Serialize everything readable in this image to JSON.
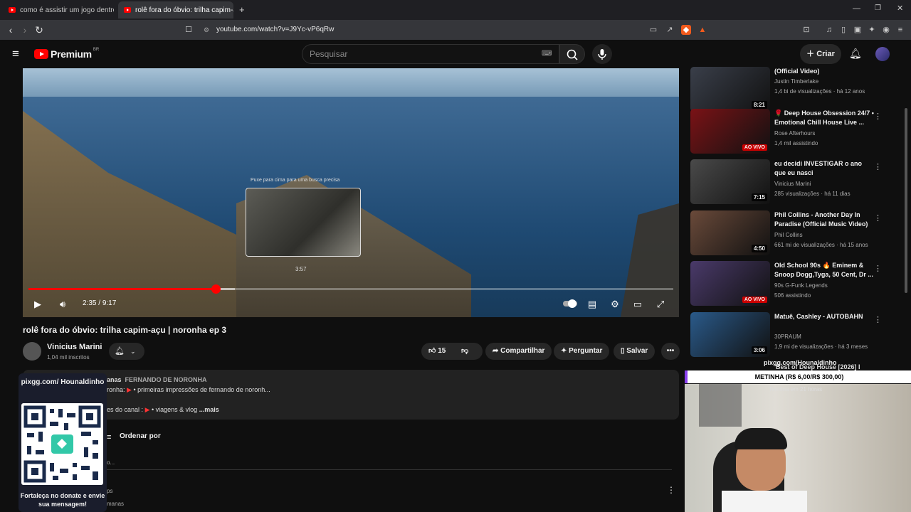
{
  "browser": {
    "tabs": [
      {
        "title": "como é assistir um jogo dentro do m"
      },
      {
        "title": "rolê fora do óbvio: trilha capim-a",
        "active": true
      }
    ],
    "url": "youtube.com/watch?v=J9Yc-vP6qRw"
  },
  "header": {
    "logo": "Premium",
    "region": "BR",
    "search_placeholder": "Pesquisar",
    "create_label": "Criar"
  },
  "player": {
    "hint": "Puxe para cima para uma busca precisa",
    "preview_time": "3:57",
    "current_time": "2:35",
    "duration": "9:17",
    "progress": 0.29,
    "buffered": 0.32
  },
  "video": {
    "title": "rolê fora do óbvio: trilha capim-açu | noronha ep 3",
    "channel": "Vinicius Marini",
    "subscribers": "1,04 mil inscritos",
    "likes": "15",
    "share_label": "Compartilhar",
    "ask_label": "Perguntar",
    "save_label": "Salvar"
  },
  "description": {
    "line1_a": "anas",
    "line1_b": "FERNANDO DE NORONHA",
    "line2_a": "ronha:",
    "line2_b": "• primeiras impressões de fernando de noronh...",
    "line3_a": "es do canal :",
    "line3_b": "• viagens & vlog",
    "more": "...mais"
  },
  "comments": {
    "sort_label": "Ordenar por",
    "frag1": "o...",
    "frag2": "ps",
    "frag3": "manas"
  },
  "recommendations": [
    {
      "title": "(Official Video)",
      "channel": "Justin Timberlake",
      "meta": "1,4 bi de visualizações · há 12 anos",
      "duration": "8:21",
      "color": "#3a3f4a"
    },
    {
      "title": "🌹 Deep House Obsession 24/7 • Emotional Chill House Live ...",
      "channel": "Rose Afterhours",
      "meta": "1,4 mil assistindo",
      "live": "AO VIVO",
      "color": "#7a1216"
    },
    {
      "title": "eu decidi INVESTIGAR o ano que eu nasci",
      "channel": "Vinicius Marini",
      "meta": "285 visualizações · há 11 dias",
      "duration": "7:15",
      "color": "#4a4a4a"
    },
    {
      "title": "Phil Collins - Another Day In Paradise (Official Music Video)",
      "channel": "Phil Collins",
      "meta": "661 mi de visualizações · há 15 anos",
      "duration": "4:50",
      "color": "#6a4a3a"
    },
    {
      "title": "Old School 90s 🔥 Eminem & Snoop Dogg,Tyga, 50 Cent, Dr ...",
      "channel": "90s G-Funk Legends",
      "meta": "506 assistindo",
      "live": "AO VIVO",
      "color": "#4a3a6a"
    },
    {
      "title": "Matuê, Cashley - AUTOBAHN",
      "channel": "30PRAUM",
      "meta": "1,9 mi de visualizações · há 3 meses",
      "duration": "3:06",
      "color": "#2a5a8a"
    }
  ],
  "overlay": {
    "qr_top": "pixgg.com/ Hounaldinho",
    "qr_bottom": "Fortaleça no donate e envie sua mensagem!",
    "dono_name": "pixgg.com/Hounaldinho",
    "dono_partial": "Best of Deep House [2026] I",
    "dono_bar": "METINHA (R$ 6,00/R$ 300,00)",
    "dono_end": "Termina em 21 horas"
  }
}
